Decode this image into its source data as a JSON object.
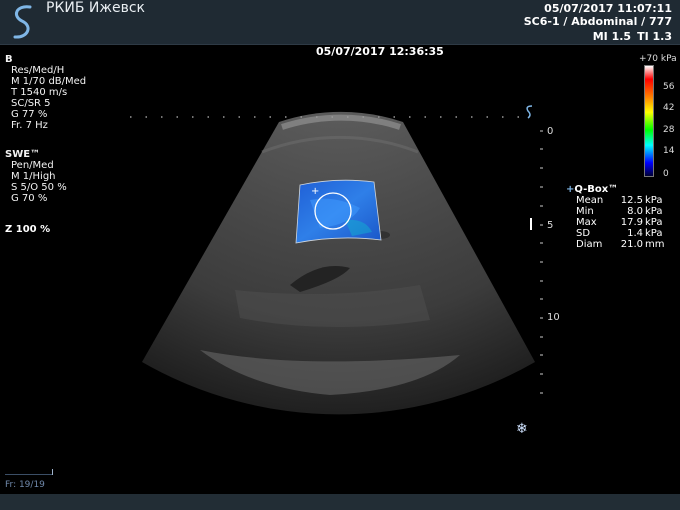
{
  "header": {
    "hospital_name": "РКИБ Ижевск",
    "datetime": "05/07/2017 11:07:11",
    "probe_preset": "SC6-1 / Abdominal / 777",
    "mi": "MI 1.5",
    "ti": "TI 1.3"
  },
  "image_datetime": "05/07/2017 12:36:35",
  "b_mode": {
    "title": "B",
    "lines": [
      "Res/Med/H",
      "M 1/70 dB/Med",
      "T 1540 m/s",
      "SC/SR 5",
      "G 77 %",
      "Fr. 7 Hz"
    ]
  },
  "swe_mode": {
    "title": "SWE™",
    "lines": [
      "Pen/Med",
      "M 1/High",
      "S 5/O 50 %",
      "G 70 %"
    ]
  },
  "zoom": "Z  100  %",
  "depth_labels": [
    "0",
    "5",
    "10"
  ],
  "colorbar": {
    "max_label": "+70 kPa",
    "labels": [
      "56",
      "42",
      "28",
      "14",
      "0"
    ]
  },
  "qbox": {
    "title": "Q-Box™",
    "stats": [
      {
        "name": "Mean",
        "value": "12.5",
        "unit": "kPa"
      },
      {
        "name": "Min",
        "value": "8.0",
        "unit": "kPa"
      },
      {
        "name": "Max",
        "value": "17.9",
        "unit": "kPa"
      },
      {
        "name": "SD",
        "value": "1.4",
        "unit": "kPa"
      },
      {
        "name": "Diam",
        "value": "21.0",
        "unit": "mm"
      }
    ]
  },
  "frame_counter": "Fr: 19/19",
  "icons": {
    "logo": "s-logo-icon",
    "probe_orientation": "s-orientation-icon",
    "freeze": "snowflake-icon",
    "qbox_marker": "plus-icon"
  }
}
